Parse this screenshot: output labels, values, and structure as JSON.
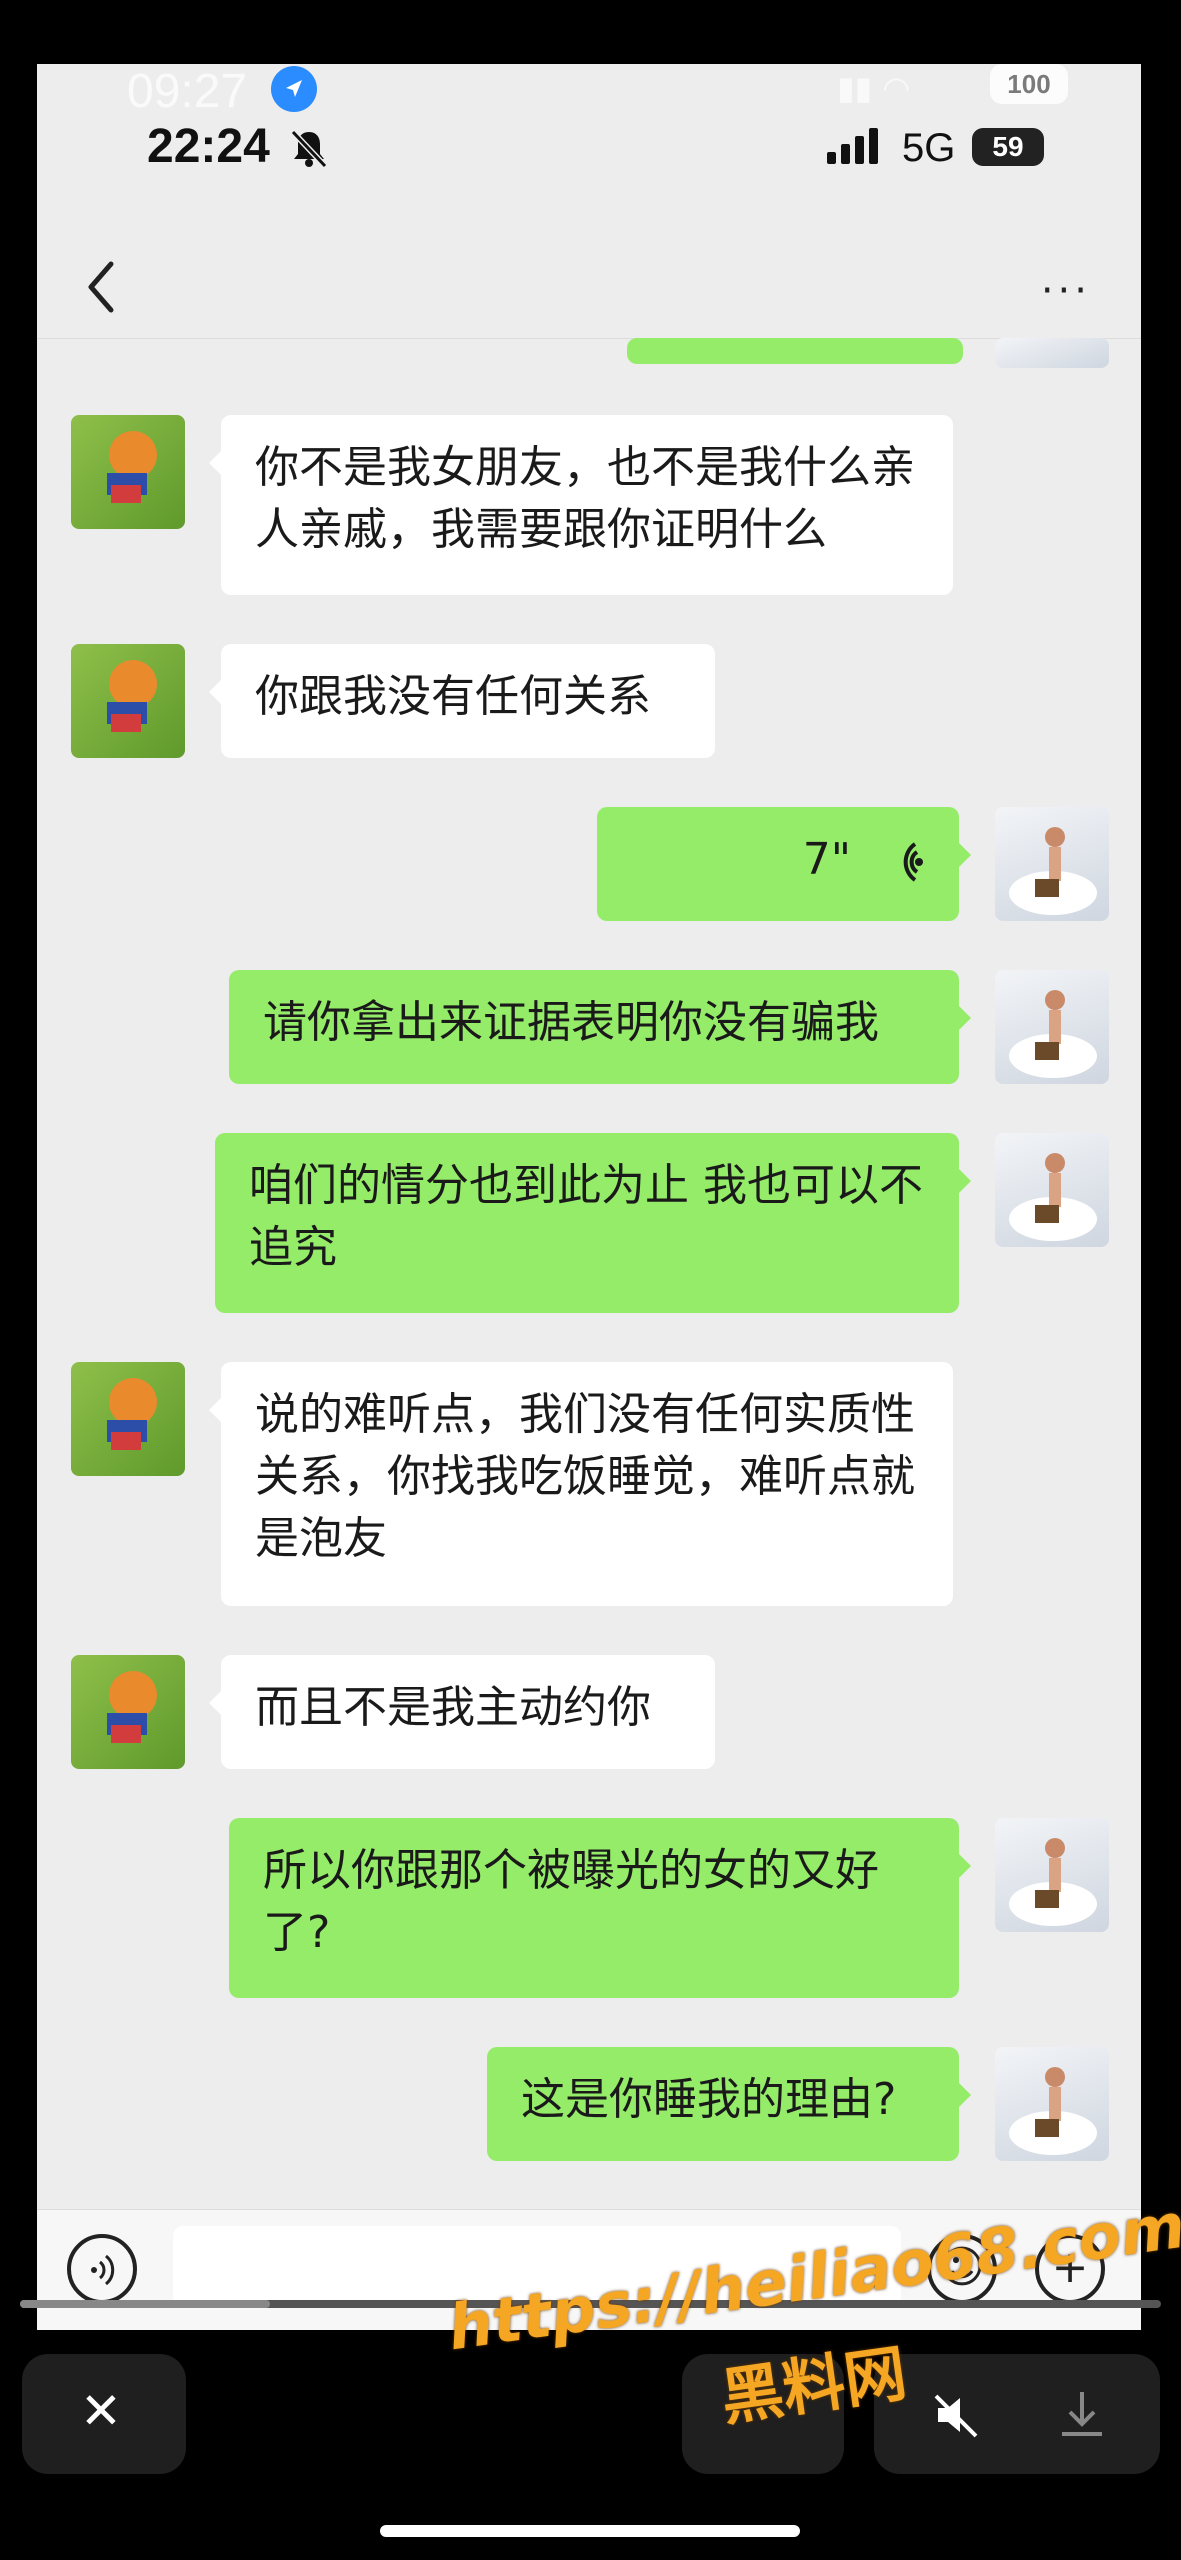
{
  "status_outer": {
    "time": "09:27",
    "battery": "100"
  },
  "status_inner": {
    "time": "22:24",
    "network": "5G",
    "battery": "59"
  },
  "navbar": {
    "more_label": "···"
  },
  "messages": [
    {
      "side": "left",
      "text": "你不是我女朋友，也不是我什么亲人亲戚，我需要跟你证明什么"
    },
    {
      "side": "left",
      "text": "你跟我没有任何关系"
    },
    {
      "side": "right",
      "type": "voice",
      "text": "7\""
    },
    {
      "side": "right",
      "text": "请你拿出来证据表明你没有骗我"
    },
    {
      "side": "right",
      "text": "咱们的情分也到此为止 我也可以不追究"
    },
    {
      "side": "left",
      "text": "说的难听点，我们没有任何实质性关系，你找我吃饭睡觉，难听点就是泡友"
    },
    {
      "side": "left",
      "text": "而且不是我主动约你"
    },
    {
      "side": "right",
      "text": "所以你跟那个被曝光的女的又好了?"
    },
    {
      "side": "right",
      "text": "这是你睡我的理由?"
    }
  ],
  "input_bar": {
    "emoji_label": "☺",
    "plus_label": "+"
  },
  "watermark": {
    "url": "https://heiliao68.com",
    "brand": "黑料网"
  },
  "controls": {
    "close_label": "✕"
  },
  "icons": [
    "back-chevron-icon",
    "more-icon",
    "voice-wave-icon",
    "voice-input-icon",
    "emoji-icon",
    "plus-icon",
    "close-icon",
    "mute-icon",
    "download-icon",
    "location-arrow-icon",
    "bell-off-icon",
    "signal-icon",
    "wifi-icon"
  ],
  "colors": {
    "chat_bg": "#ededed",
    "bubble_self": "#95ec69",
    "bubble_other": "#ffffff",
    "watermark": "#f5a623"
  }
}
